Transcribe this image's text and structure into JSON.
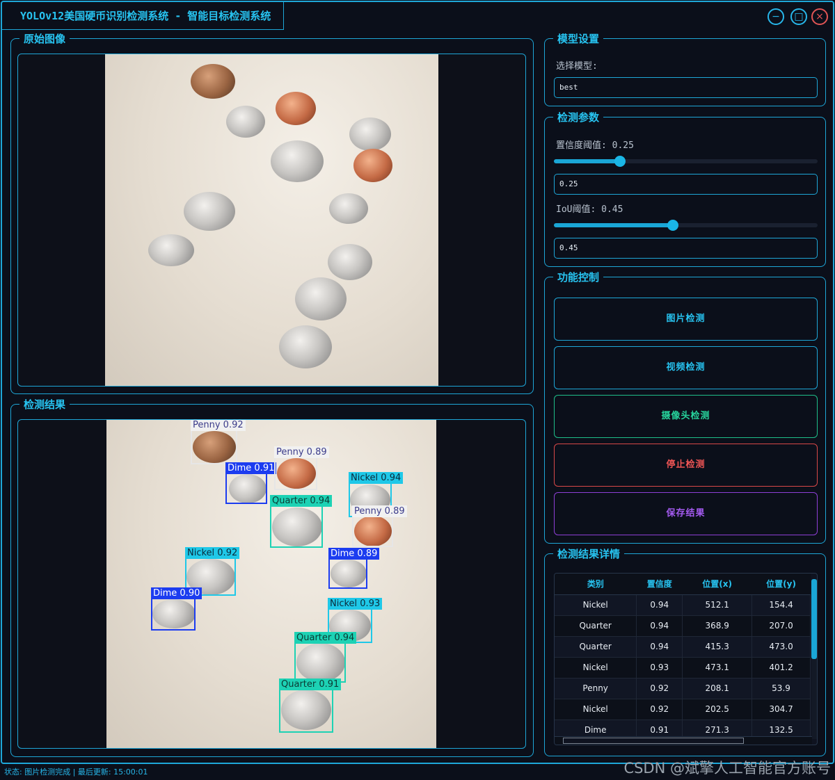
{
  "app": {
    "title": "YOLOv12美国硬币识别检测系统 - 智能目标检测系统"
  },
  "window_controls": {
    "minimize": "−",
    "maximize": "□",
    "close": "×"
  },
  "panels": {
    "original_image": "原始图像",
    "detection_result": "检测结果",
    "model_settings": "模型设置",
    "detect_params": "检测参数",
    "function_control": "功能控制",
    "result_details": "检测结果详情"
  },
  "model": {
    "select_label": "选择模型:",
    "selected": "best"
  },
  "params": {
    "conf_label": "置信度阈值: 0.25",
    "conf_value": "0.25",
    "conf_level": 0.25,
    "iou_label": "IoU阈值: 0.45",
    "iou_value": "0.45",
    "iou_level": 0.45
  },
  "buttons": {
    "image_detect": "图片检测",
    "video_detect": "视频检测",
    "camera_detect": "摄像头检测",
    "stop_detect": "停止检测",
    "save_result": "保存结果"
  },
  "detections": [
    {
      "label": "Penny 0.92",
      "cls": "penny"
    },
    {
      "label": "Dime 0.91",
      "cls": "dime"
    },
    {
      "label": "Penny 0.89",
      "cls": "penny"
    },
    {
      "label": "Nickel 0.94",
      "cls": "nickel"
    },
    {
      "label": "Quarter 0.94",
      "cls": "quarter"
    },
    {
      "label": "Penny 0.89",
      "cls": "penny"
    },
    {
      "label": "Nickel 0.92",
      "cls": "nickel"
    },
    {
      "label": "Dime 0.89",
      "cls": "dime"
    },
    {
      "label": "Dime 0.90",
      "cls": "dime"
    },
    {
      "label": "Nickel 0.93",
      "cls": "nickel"
    },
    {
      "label": "Quarter 0.94",
      "cls": "quarter"
    },
    {
      "label": "Quarter 0.91",
      "cls": "quarter"
    }
  ],
  "table": {
    "headers": [
      "类别",
      "置信度",
      "位置(x)",
      "位置(y)"
    ],
    "rows": [
      [
        "Nickel",
        "0.94",
        "512.1",
        "154.4"
      ],
      [
        "Quarter",
        "0.94",
        "368.9",
        "207.0"
      ],
      [
        "Quarter",
        "0.94",
        "415.3",
        "473.0"
      ],
      [
        "Nickel",
        "0.93",
        "473.1",
        "401.2"
      ],
      [
        "Penny",
        "0.92",
        "208.1",
        "53.9"
      ],
      [
        "Nickel",
        "0.92",
        "202.5",
        "304.7"
      ],
      [
        "Dime",
        "0.91",
        "271.3",
        "132.5"
      ]
    ]
  },
  "status": {
    "text": "状态: 图片检测完成 | 最后更新: 15:00:01"
  },
  "watermark": "CSDN @斌擎人工智能官方账号"
}
